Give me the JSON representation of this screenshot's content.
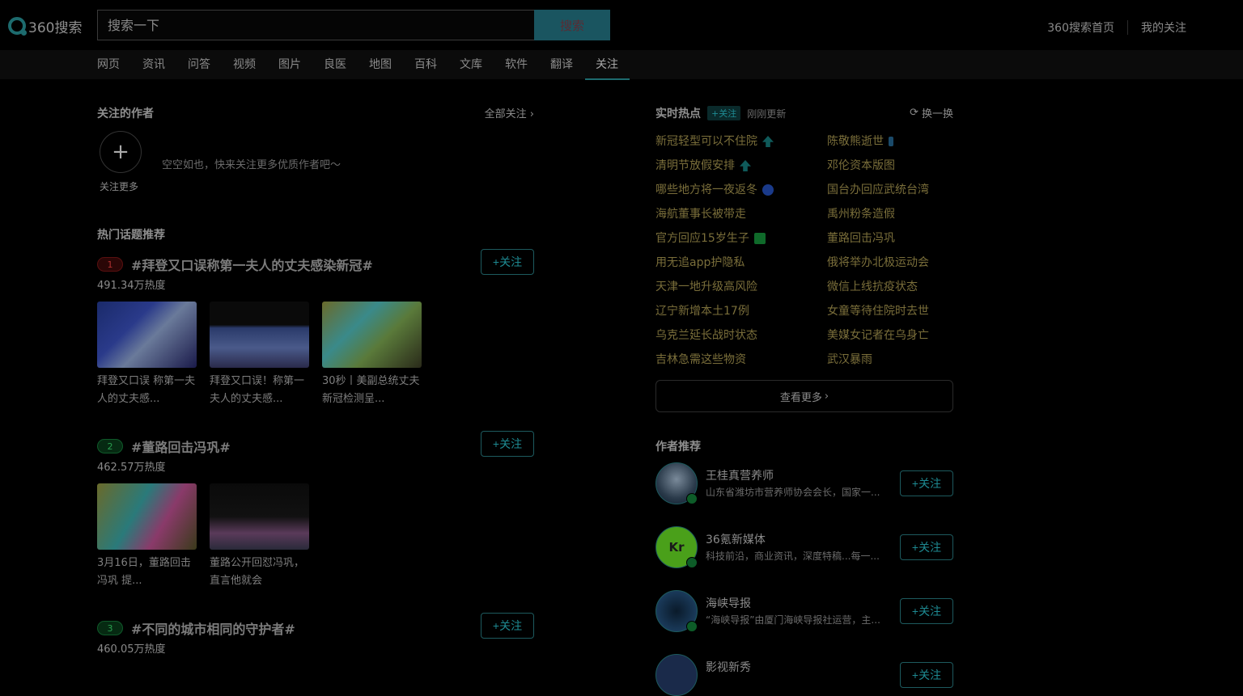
{
  "header": {
    "logo_text": "360搜索",
    "search_placeholder": "搜索一下",
    "search_button": "搜索",
    "links": [
      "360搜索首页",
      "我的关注"
    ]
  },
  "nav": {
    "items": [
      "网页",
      "资讯",
      "问答",
      "视频",
      "图片",
      "良医",
      "地图",
      "百科",
      "文库",
      "软件",
      "翻译",
      "关注"
    ],
    "active_index": 11
  },
  "followed_authors": {
    "title": "关注的作者",
    "all_follow": "全部关注",
    "add_more": "关注更多",
    "empty_tip": "空空如也，快来关注更多优质作者吧～"
  },
  "hot_topics": {
    "title": "热门话题推荐",
    "follow_label": "+关注",
    "items": [
      {
        "rank": "1",
        "name": "#拜登又口误称第一夫人的丈夫感染新冠#",
        "heat": "491.34万热度",
        "thumbs": [
          {
            "caption": "拜登又口误 称第一夫人的丈夫感..."
          },
          {
            "caption": "拜登又口误！称第一夫人的丈夫感..."
          },
          {
            "caption": "30秒丨美副总统丈夫新冠检测呈..."
          }
        ]
      },
      {
        "rank": "2",
        "name": "#董路回击冯巩#",
        "heat": "462.57万热度",
        "thumbs": [
          {
            "caption": "3月16日，董路回击冯巩 提..."
          },
          {
            "caption": "董路公开回怼冯巩，直言他就会"
          }
        ]
      },
      {
        "rank": "3",
        "name": "#不同的城市相同的守护者#",
        "heat": "460.05万热度",
        "thumbs": []
      }
    ]
  },
  "realtime": {
    "title": "实时热点",
    "tag": "+关注",
    "updated": "刚刚更新",
    "refresh": "换一换",
    "left": [
      {
        "text": "新冠轻型可以不住院",
        "icon": "up-arrow-icon"
      },
      {
        "text": "清明节放假安排",
        "icon": "up-arrow-icon"
      },
      {
        "text": "哪些地方将一夜返冬",
        "icon": "new-icon"
      },
      {
        "text": "海航董事长被带走",
        "icon": ""
      },
      {
        "text": "官方回应15岁生子",
        "icon": "hot-icon"
      },
      {
        "text": "用无追app护隐私",
        "icon": ""
      },
      {
        "text": "天津一地升级高风险",
        "icon": ""
      },
      {
        "text": "辽宁新增本土17例",
        "icon": ""
      },
      {
        "text": "乌克兰延长战时状态",
        "icon": ""
      },
      {
        "text": "吉林急需这些物资",
        "icon": ""
      }
    ],
    "right": [
      {
        "text": "陈敬熊逝世",
        "icon": "candle-icon"
      },
      {
        "text": "邓伦资本版图",
        "icon": ""
      },
      {
        "text": "国台办回应武统台湾",
        "icon": ""
      },
      {
        "text": "禹州粉条造假",
        "icon": ""
      },
      {
        "text": "董路回击冯巩",
        "icon": ""
      },
      {
        "text": "俄将举办北极运动会",
        "icon": ""
      },
      {
        "text": "微信上线抗疫状态",
        "icon": ""
      },
      {
        "text": "女童等待住院时去世",
        "icon": ""
      },
      {
        "text": "美媒女记者在乌身亡",
        "icon": ""
      },
      {
        "text": "武汉暴雨",
        "icon": ""
      }
    ],
    "see_more": "查看更多"
  },
  "author_rec": {
    "title": "作者推荐",
    "follow_label": "+关注",
    "items": [
      {
        "name": "王桂真营养师",
        "desc": "山东省潍坊市营养师协会会长，国家一..."
      },
      {
        "name": "36氪新媒体",
        "desc": "科技前沿，商业资讯，深度特稿...每一..."
      },
      {
        "name": "海峡导报",
        "desc": "“海峡导报”由厦门海峡导报社运营，主..."
      },
      {
        "name": "影视新秀",
        "desc": ""
      }
    ]
  },
  "colors": {
    "accent": "#1d6b6e",
    "follow_text": "#1e8a92",
    "hot_text": "#7a6e3a",
    "rank1": "#5a1010",
    "rank2": "#0f5a2a",
    "rank3": "#0f5a2a"
  }
}
